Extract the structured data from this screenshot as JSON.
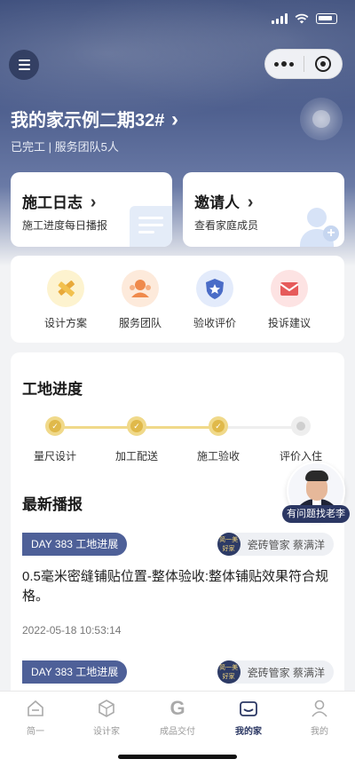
{
  "header": {
    "project_title": "我的家示例二期32#",
    "project_title_chevron": "›",
    "project_subtitle": "已完工 | 服务团队5人"
  },
  "cards": {
    "log": {
      "title": "施工日志",
      "chevron": "›",
      "desc": "施工进度每日播报"
    },
    "invite": {
      "title": "邀请人",
      "chevron": "›",
      "desc": "查看家庭成员"
    }
  },
  "quick_actions": [
    {
      "label": "设计方案",
      "icon": "ruler-pencil-icon"
    },
    {
      "label": "服务团队",
      "icon": "team-icon"
    },
    {
      "label": "验收评价",
      "icon": "shield-star-icon"
    },
    {
      "label": "投诉建议",
      "icon": "envelope-icon"
    }
  ],
  "progress": {
    "title": "工地进度",
    "steps": [
      {
        "label": "量尺设计",
        "done": true
      },
      {
        "label": "加工配送",
        "done": true
      },
      {
        "label": "施工验收",
        "done": true
      },
      {
        "label": "评价入住",
        "done": false
      }
    ]
  },
  "news": {
    "title": "最新播报",
    "items": [
      {
        "tag": "DAY 383 工地进展",
        "author_badge": "简一美好家",
        "author": "瓷砖管家 蔡满洋",
        "text": "0.5毫米密缝铺贴位置-整体验收:整体铺贴效果符合规格。",
        "time": "2022-05-18 10:53:14"
      },
      {
        "tag": "DAY 383 工地进展",
        "author_badge": "简一美好家",
        "author": "瓷砖管家 蔡满洋"
      }
    ]
  },
  "advisor": {
    "label": "有问题找老李"
  },
  "tabbar": [
    {
      "label": "简一",
      "icon": "home-icon",
      "active": false
    },
    {
      "label": "设计家",
      "icon": "cube-icon",
      "active": false
    },
    {
      "label": "成品交付",
      "icon": "g-logo-icon",
      "active": false
    },
    {
      "label": "我的家",
      "icon": "my-home-icon",
      "active": true
    },
    {
      "label": "我的",
      "icon": "user-icon",
      "active": false
    }
  ],
  "colors": {
    "primary": "#2b3763",
    "tag": "#4e6098",
    "progress": "#e0b94a"
  }
}
